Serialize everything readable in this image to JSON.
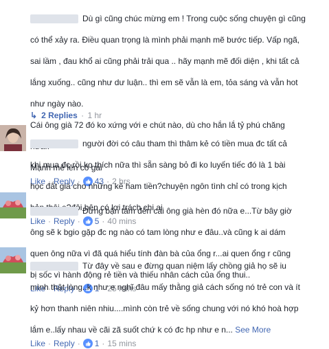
{
  "comments": [
    {
      "text_lines": [
        "Dù gì cũng chúc mừng em ! Trong cuộc sống chuyện gì cũng",
        "có thể xảy ra. Điều quan trọng là mình phải mạnh mẽ bước tiếp. Vấp ngã,",
        "sai lầm , đau khổ ai cũng phải trải qua .. hãy mạnh mẽ đối diện , khi tất cả",
        "lắng xuống.. cũng như dư luận.. thì em sẽ vẫn là em, tỏa sáng và vẫn hot",
        "như ngày nào.",
        "Cái ông già 72 đó ko xứng với e chút nào, dù cho hắn lắ tỷ phú chăng",
        "nữa..",
        "Mạnh mẽ lên cô gái"
      ],
      "like": "Like",
      "reply": "Reply",
      "like_count": "43",
      "time": "2 hrs"
    },
    {
      "text_lines": [
        "người đời có câu tham thì thâm kẻ có tiền mua đc tất cả",
        "khi mua đc rồi ko thích nữa thì sẵn sàng bỏ đi ko luyến tiếc đó là 1 bài",
        "học đắt giá cho những kẻ ham tiền?chuyện ngôn tình chỉ có trong kịch",
        "bản thôi e?đôi bên có lợi trách chi ai"
      ],
      "like": "Like",
      "reply": "Reply",
      "like_count": "5",
      "time": "40 mins"
    },
    {
      "text_lines": [
        "Đừng bận tâm đến cái ông già hèn đó nữa e...Từ bây giờ",
        "ông sẽ k bgio gặp đc ng nào có tam lòng như e đâu..và cũng k ai dám",
        "quen ông nữa vì đã quá hiểu tính đàn bà của ổng r...ai quen ổng r cũng",
        "bị sốc vì hành động rẻ tiền và thiếu nhân cách của ổng thui.."
      ],
      "like": "Like",
      "reply": "Reply",
      "like_count": "1",
      "time": "25 mins"
    },
    {
      "text_lines": [
        "Từ đây về sau e đừng quan niệm lấy chồng giả họ sẽ iu",
        "mình thật lòng..k như e nghĩ đâu mấy thằng giả cách sống nó trẻ con và ít",
        "kỷ hơn thanh niên nhiu....mình còn trẻ về sống chung với nó khó hoà hợp",
        "lắm e..lấy nhau về cãi zã suốt chứ k có đc hp như e n... "
      ],
      "see_more": "See More",
      "like": "Like",
      "reply": "Reply",
      "like_count": "1",
      "time": "15 mins"
    }
  ],
  "replies_link": {
    "label": "2 Replies",
    "time": "1 hr"
  },
  "colors": {
    "link": "#4267b2",
    "meta": "#90949c",
    "text": "#1d2129",
    "like_badge": "#5890ff"
  }
}
